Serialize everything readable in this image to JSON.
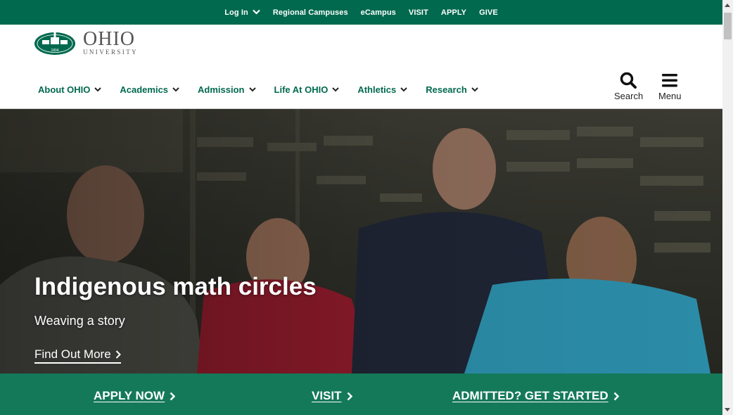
{
  "utility_bar": {
    "login": "Log In",
    "regional_campuses": "Regional Campuses",
    "ecampus": "eCampus",
    "visit": "VISIT",
    "apply": "APPLY",
    "give": "GIVE"
  },
  "logo": {
    "name": "OHIO",
    "subname": "UNIVERSITY",
    "seal_year": "1804"
  },
  "main_nav": [
    {
      "label": "About OHIO"
    },
    {
      "label": "Academics"
    },
    {
      "label": "Admission"
    },
    {
      "label": "Life At OHIO"
    },
    {
      "label": "Athletics"
    },
    {
      "label": "Research"
    }
  ],
  "tools": {
    "search_label": "Search",
    "menu_label": "Menu"
  },
  "hero": {
    "title": "Indigenous math circles",
    "subtitle": "Weaving a story",
    "cta": "Find Out More"
  },
  "action_bar": {
    "apply": "APPLY NOW",
    "visit": "VISIT",
    "admitted": "ADMITTED? GET STARTED"
  },
  "colors": {
    "brand_green": "#00694e",
    "white": "#ffffff"
  }
}
